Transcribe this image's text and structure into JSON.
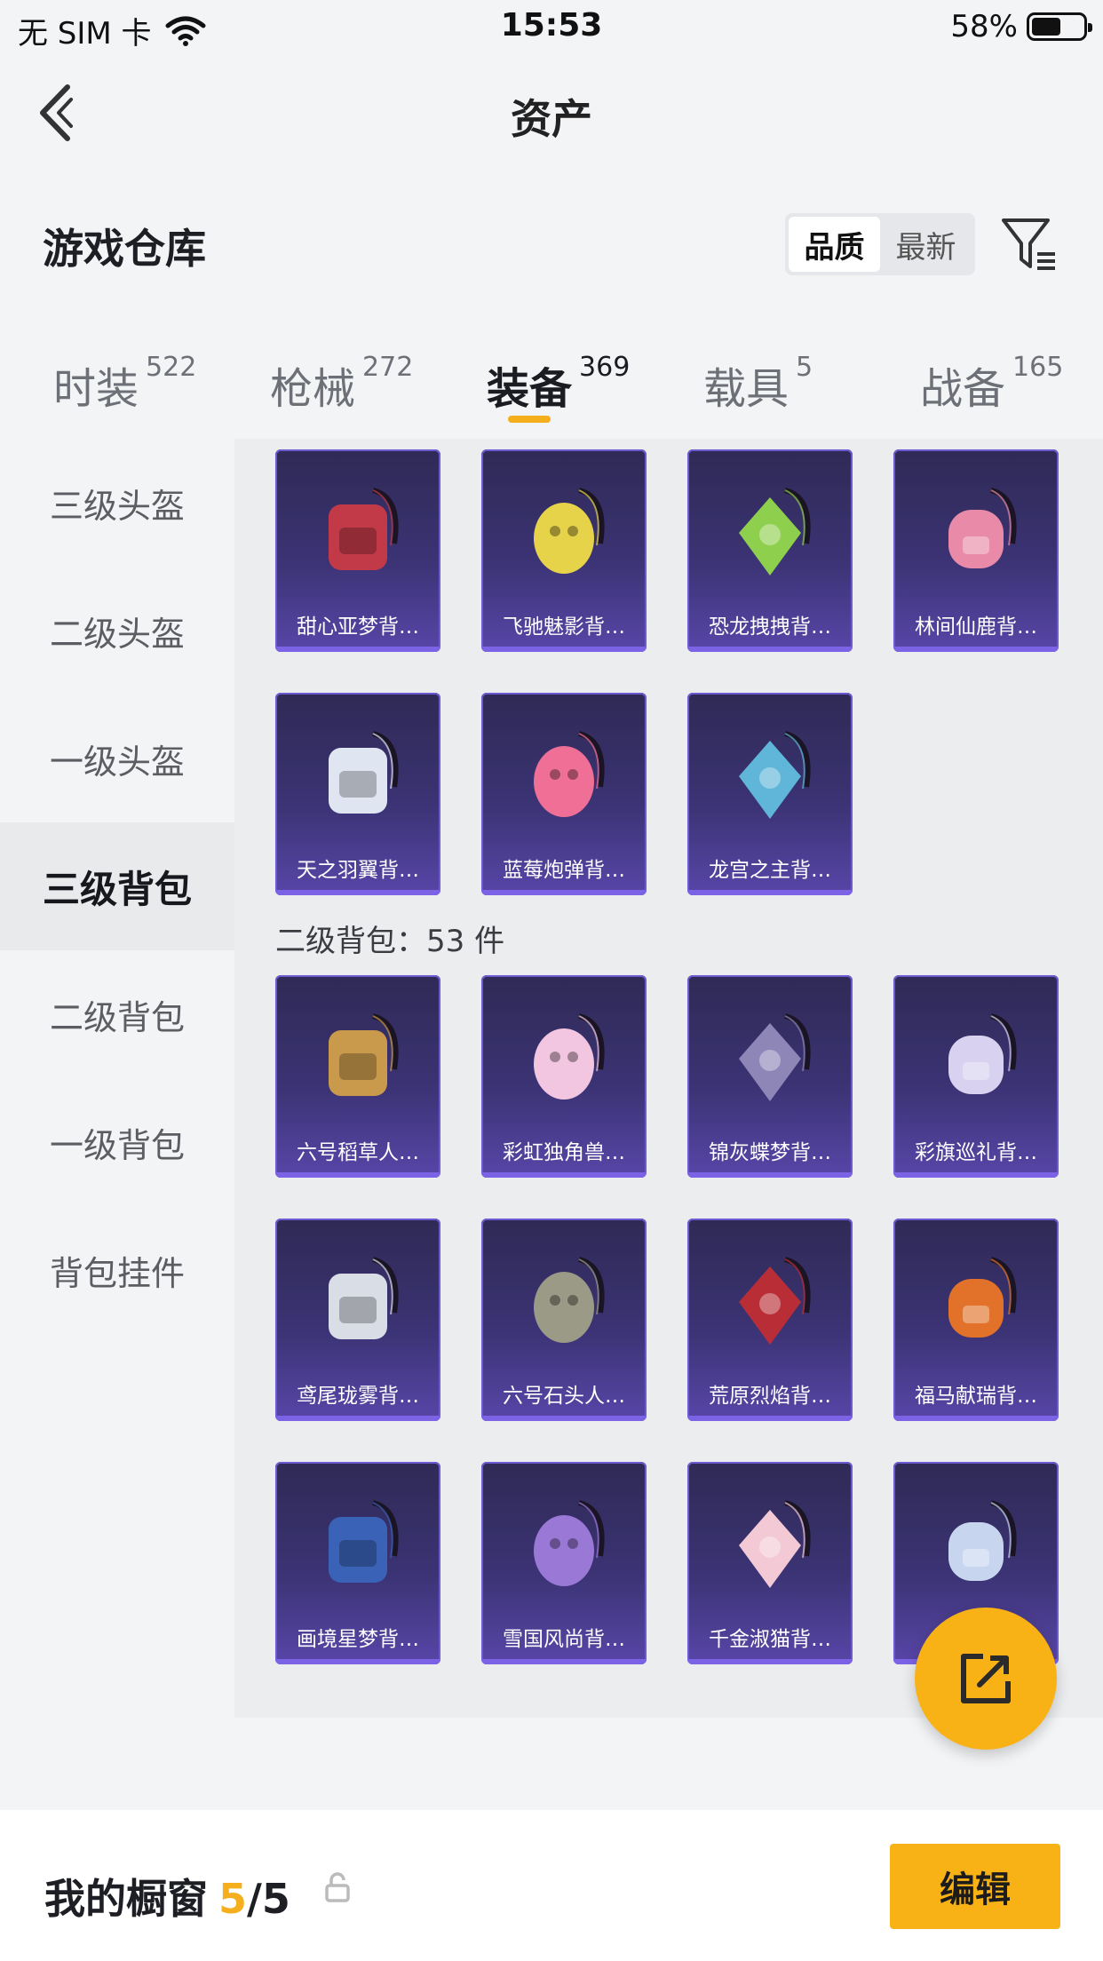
{
  "status_bar": {
    "carrier": "无 SIM 卡",
    "time": "15:53",
    "battery": "58%",
    "battery_level": 0.58
  },
  "nav": {
    "title": "资产"
  },
  "header": {
    "title": "游戏仓库",
    "sort_options": [
      "品质",
      "最新"
    ],
    "active_sort": "品质"
  },
  "tabs": [
    {
      "label": "时装",
      "count": "522"
    },
    {
      "label": "枪械",
      "count": "272"
    },
    {
      "label": "装备",
      "count": "369",
      "active": true
    },
    {
      "label": "载具",
      "count": "5"
    },
    {
      "label": "战备",
      "count": "165"
    }
  ],
  "sidebar": [
    {
      "label": "三级头盔"
    },
    {
      "label": "二级头盔"
    },
    {
      "label": "一级头盔"
    },
    {
      "label": "三级背包",
      "active": true
    },
    {
      "label": "二级背包"
    },
    {
      "label": "一级背包"
    },
    {
      "label": "背包挂件"
    }
  ],
  "groups": {
    "level3": {
      "items": [
        {
          "name": "甜心亚梦背…",
          "color": "#c23a48"
        },
        {
          "name": "飞驰魅影背…",
          "color": "#e6d34a"
        },
        {
          "name": "恐龙拽拽背…",
          "color": "#8fcf4e"
        },
        {
          "name": "林间仙鹿背…",
          "color": "#e88aa8"
        },
        {
          "name": "天之羽翼背…",
          "color": "#dfe6f2"
        },
        {
          "name": "蓝莓炮弹背…",
          "color": "#ef6f96"
        },
        {
          "name": "龙宫之主背…",
          "color": "#5fb6d9"
        }
      ]
    },
    "level2": {
      "label": "二级背包：53 件",
      "items": [
        {
          "name": "六号稻草人…",
          "color": "#c99a4c"
        },
        {
          "name": "彩虹独角兽…",
          "color": "#f2c6e0"
        },
        {
          "name": "锦灰蝶梦背…",
          "color": "#8f86b8"
        },
        {
          "name": "彩旗巡礼背…",
          "color": "#d8d2f0"
        },
        {
          "name": "鸢尾珑雾背…",
          "color": "#d9dde6"
        },
        {
          "name": "六号石头人…",
          "color": "#9a9a86"
        },
        {
          "name": "荒原烈焰背…",
          "color": "#b92e36"
        },
        {
          "name": "福马献瑞背…",
          "color": "#e2722a"
        },
        {
          "name": "画境星梦背…",
          "color": "#3a63b8"
        },
        {
          "name": "雪国风尚背…",
          "color": "#9a78d6"
        },
        {
          "name": "千金淑猫背…",
          "color": "#f3c9d6"
        },
        {
          "name": "风…",
          "color": "#c7d6ee"
        }
      ]
    }
  },
  "showcase": {
    "title": "我的橱窗",
    "current": "5",
    "total": "/5",
    "edit_label": "编辑"
  }
}
